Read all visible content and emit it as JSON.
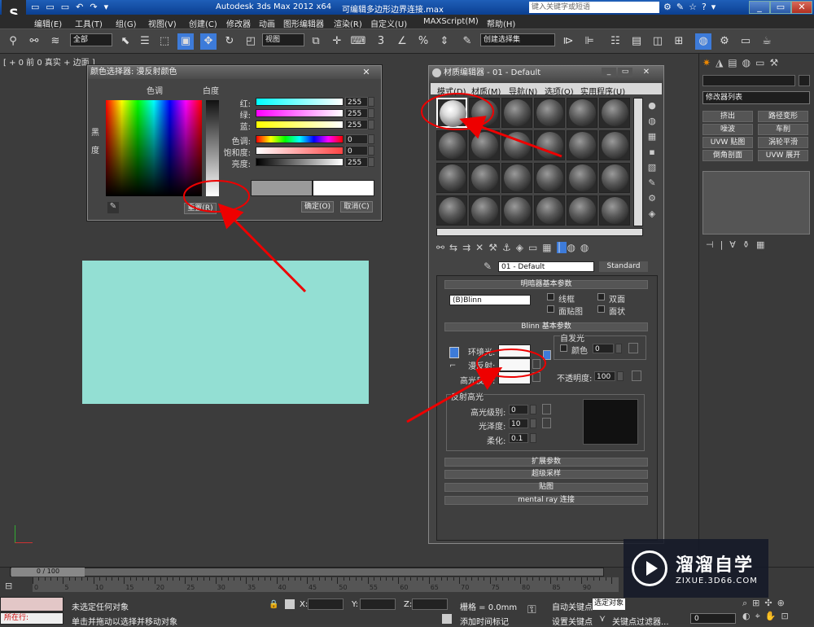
{
  "app": {
    "title": "Autodesk 3ds Max  2012 x64",
    "filename": "可编辑多边形边界连接.max",
    "search_placeholder": "键入关键字或短语"
  },
  "menu": [
    "编辑(E)",
    "工具(T)",
    "组(G)",
    "视图(V)",
    "创建(C)",
    "修改器",
    "动画",
    "图形编辑器",
    "渲染(R)",
    "自定义(U)",
    "MAXScript(M)",
    "帮助(H)"
  ],
  "toolbar": {
    "filter_value": "全部",
    "refcoord_value": "视图",
    "named_sel_value": "创建选择集"
  },
  "viewport": {
    "label": "[ + 0 前 0 真实 + 边面 ]",
    "rect_color": "#93dfd3"
  },
  "color_selector": {
    "title": "颜色选择器: 漫反射颜色",
    "hue_label": "色调",
    "white_label": "白度",
    "black_label": "黑",
    "degree_label": "度",
    "sliders": [
      {
        "label": "红:",
        "value": "255"
      },
      {
        "label": "绿:",
        "value": "255"
      },
      {
        "label": "蓝:",
        "value": "255"
      },
      {
        "label": "色调:",
        "value": "0"
      },
      {
        "label": "饱和度:",
        "value": "0"
      },
      {
        "label": "亮度:",
        "value": "255"
      }
    ],
    "reset_label": "重置(R)",
    "ok_label": "确定(O)",
    "cancel_label": "取消(C)"
  },
  "material_editor": {
    "title": "材质编辑器 - 01 - Default",
    "menu": [
      "模式(D)",
      "材质(M)",
      "导航(N)",
      "选项(O)",
      "实用程序(U)"
    ],
    "material_name": "01 - Default",
    "material_type": "Standard",
    "shader_rollout": "明暗器基本参数",
    "shader": "(B)Blinn",
    "wire": "线框",
    "two_sided": "双面",
    "face_map": "面贴图",
    "faceted": "面状",
    "blinn_rollout": "Blinn 基本参数",
    "self_illum": "自发光",
    "color_label": "颜色",
    "self_illum_value": "0",
    "ambient": "环境光:",
    "diffuse": "漫反射:",
    "specular": "高光反射:",
    "opacity_label": "不透明度:",
    "opacity_value": "100",
    "spec_highlights": "反射高光",
    "spec_level_label": "高光级别:",
    "spec_level_value": "0",
    "gloss_label": "光泽度:",
    "gloss_value": "10",
    "soften_label": "柔化:",
    "soften_value": "0.1",
    "rollouts": [
      "扩展参数",
      "超级采样",
      "贴图",
      "mental ray 连接"
    ]
  },
  "command_panel": {
    "modifier_list": "修改器列表",
    "buttons": [
      "挤出",
      "路径变形",
      "噪波",
      "车削",
      "UVW 贴图",
      "涡轮平滑",
      "倒角剖面",
      "UVW 展开"
    ]
  },
  "timeline": {
    "frame": "0 / 100",
    "ruler_labels": [
      "0",
      "5",
      "10",
      "15",
      "20",
      "25",
      "30",
      "35",
      "40",
      "45",
      "50",
      "55",
      "60",
      "65",
      "70",
      "75",
      "80",
      "85",
      "90"
    ],
    "status_top": "未选定任何对象",
    "status_bottom": "单击并拖动以选择并移动对象",
    "running_label": "所在行:",
    "x_label": "X:",
    "y_label": "Y:",
    "z_label": "Z:",
    "grid": "栅格 = 0.0mm",
    "auto_key": "自动关键点",
    "set_key": "设置关键点",
    "selected_value": "选定对象",
    "key_filters": "关键点过滤器...",
    "add_time_tag": "添加时间标记",
    "frame_value": "0"
  },
  "watermark": {
    "cn": "溜溜自学",
    "en": "ZIXUE.3D66.COM"
  }
}
